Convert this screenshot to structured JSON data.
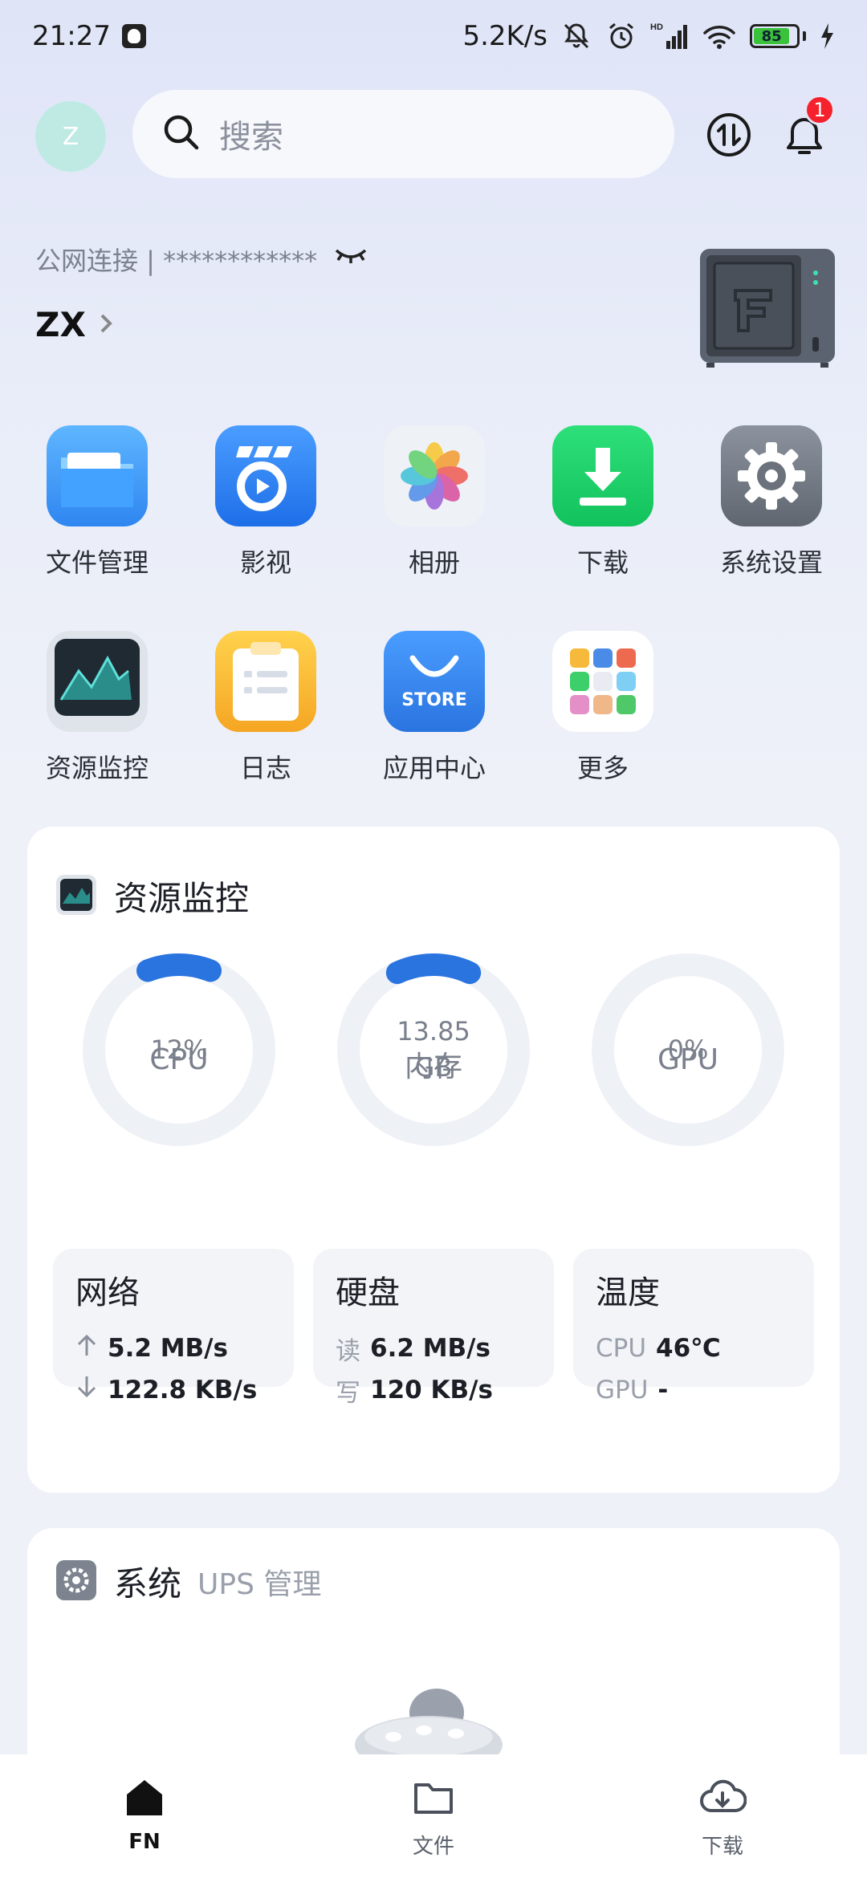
{
  "status_bar": {
    "time": "21:27",
    "net_speed": "5.2K/s",
    "battery": "85",
    "signal_label": "HD"
  },
  "header": {
    "avatar_letter": "Z",
    "search_placeholder": "搜索",
    "notification_count": "1"
  },
  "connection": {
    "label": "公网连接 | ************",
    "device_name": "ZX"
  },
  "apps": [
    {
      "label": "文件管理",
      "icon": "folder-icon"
    },
    {
      "label": "影视",
      "icon": "video-icon"
    },
    {
      "label": "相册",
      "icon": "photos-icon"
    },
    {
      "label": "下载",
      "icon": "download-icon"
    },
    {
      "label": "系统设置",
      "icon": "gear-icon"
    },
    {
      "label": "资源监控",
      "icon": "monitor-icon"
    },
    {
      "label": "日志",
      "icon": "log-icon"
    },
    {
      "label": "应用中心",
      "icon": "store-icon"
    },
    {
      "label": "更多",
      "icon": "more-icon"
    }
  ],
  "store_text": "STORE",
  "monitor": {
    "title": "资源监控",
    "rings": [
      {
        "label": "CPU",
        "value": "12%",
        "unit": "",
        "fraction": 0.12
      },
      {
        "label": "内存",
        "value": "13.85",
        "unit": "GB",
        "fraction": 0.14
      },
      {
        "label": "GPU",
        "value": "0%",
        "unit": "",
        "fraction": 0
      }
    ],
    "network": {
      "title": "网络",
      "up": "5.2 MB/s",
      "down": "122.8 KB/s"
    },
    "disk": {
      "title": "硬盘",
      "read_key": "读",
      "read": "6.2 MB/s",
      "write_key": "写",
      "write": "120 KB/s"
    },
    "temp": {
      "title": "温度",
      "cpu_key": "CPU",
      "cpu": "46℃",
      "gpu_key": "GPU",
      "gpu": "-"
    }
  },
  "system": {
    "title": "系统",
    "subtitle": "UPS 管理"
  },
  "nav": [
    {
      "label": "FN",
      "active": true
    },
    {
      "label": "文件",
      "active": false
    },
    {
      "label": "下载",
      "active": false
    }
  ],
  "colors": {
    "accent": "#2a74e0",
    "ring_track": "#eef1f6",
    "badge": "#f5222d"
  }
}
